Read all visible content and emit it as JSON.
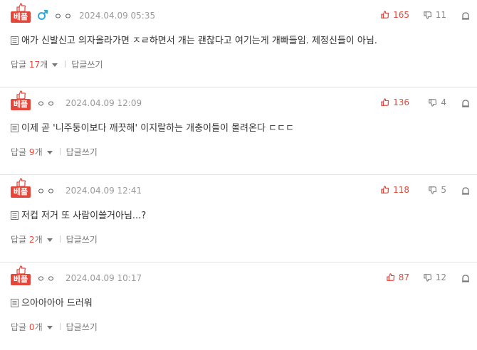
{
  "badge_label": "베플",
  "reply_prefix": "답글",
  "reply_unit": "개",
  "write_reply_label": "답글쓰기",
  "comments": [
    {
      "nickname": "ㅇㅇ",
      "date": "2024.04.09 05:35",
      "likes": "165",
      "dislikes": "11",
      "text": "애가 신발신고 의자올라가면 ㅈㄹ하면서 개는 괜찮다고 여기는게 개빠들임. 제정신들이 아님.",
      "reply_count": "17",
      "has_gender_icon": true
    },
    {
      "nickname": "ㅇㅇ",
      "date": "2024.04.09 12:09",
      "likes": "136",
      "dislikes": "4",
      "text": "이제 곧 '니주둥이보다 깨끗해' 이지랄하는 개충이들이 몰려온다 ㄷㄷㄷ",
      "reply_count": "9",
      "has_gender_icon": false
    },
    {
      "nickname": "ㅇㅇ",
      "date": "2024.04.09 12:41",
      "likes": "118",
      "dislikes": "5",
      "text": "저컵 저거 또 사람이쓸거아님...?",
      "reply_count": "2",
      "has_gender_icon": false
    },
    {
      "nickname": "ㅇㅇ",
      "date": "2024.04.09 10:17",
      "likes": "87",
      "dislikes": "12",
      "text": "으아아아아 드러워",
      "reply_count": "0",
      "has_gender_icon": false
    }
  ],
  "colors": {
    "accent": "#e4473a",
    "gender_icon": "#2aa9e0"
  }
}
